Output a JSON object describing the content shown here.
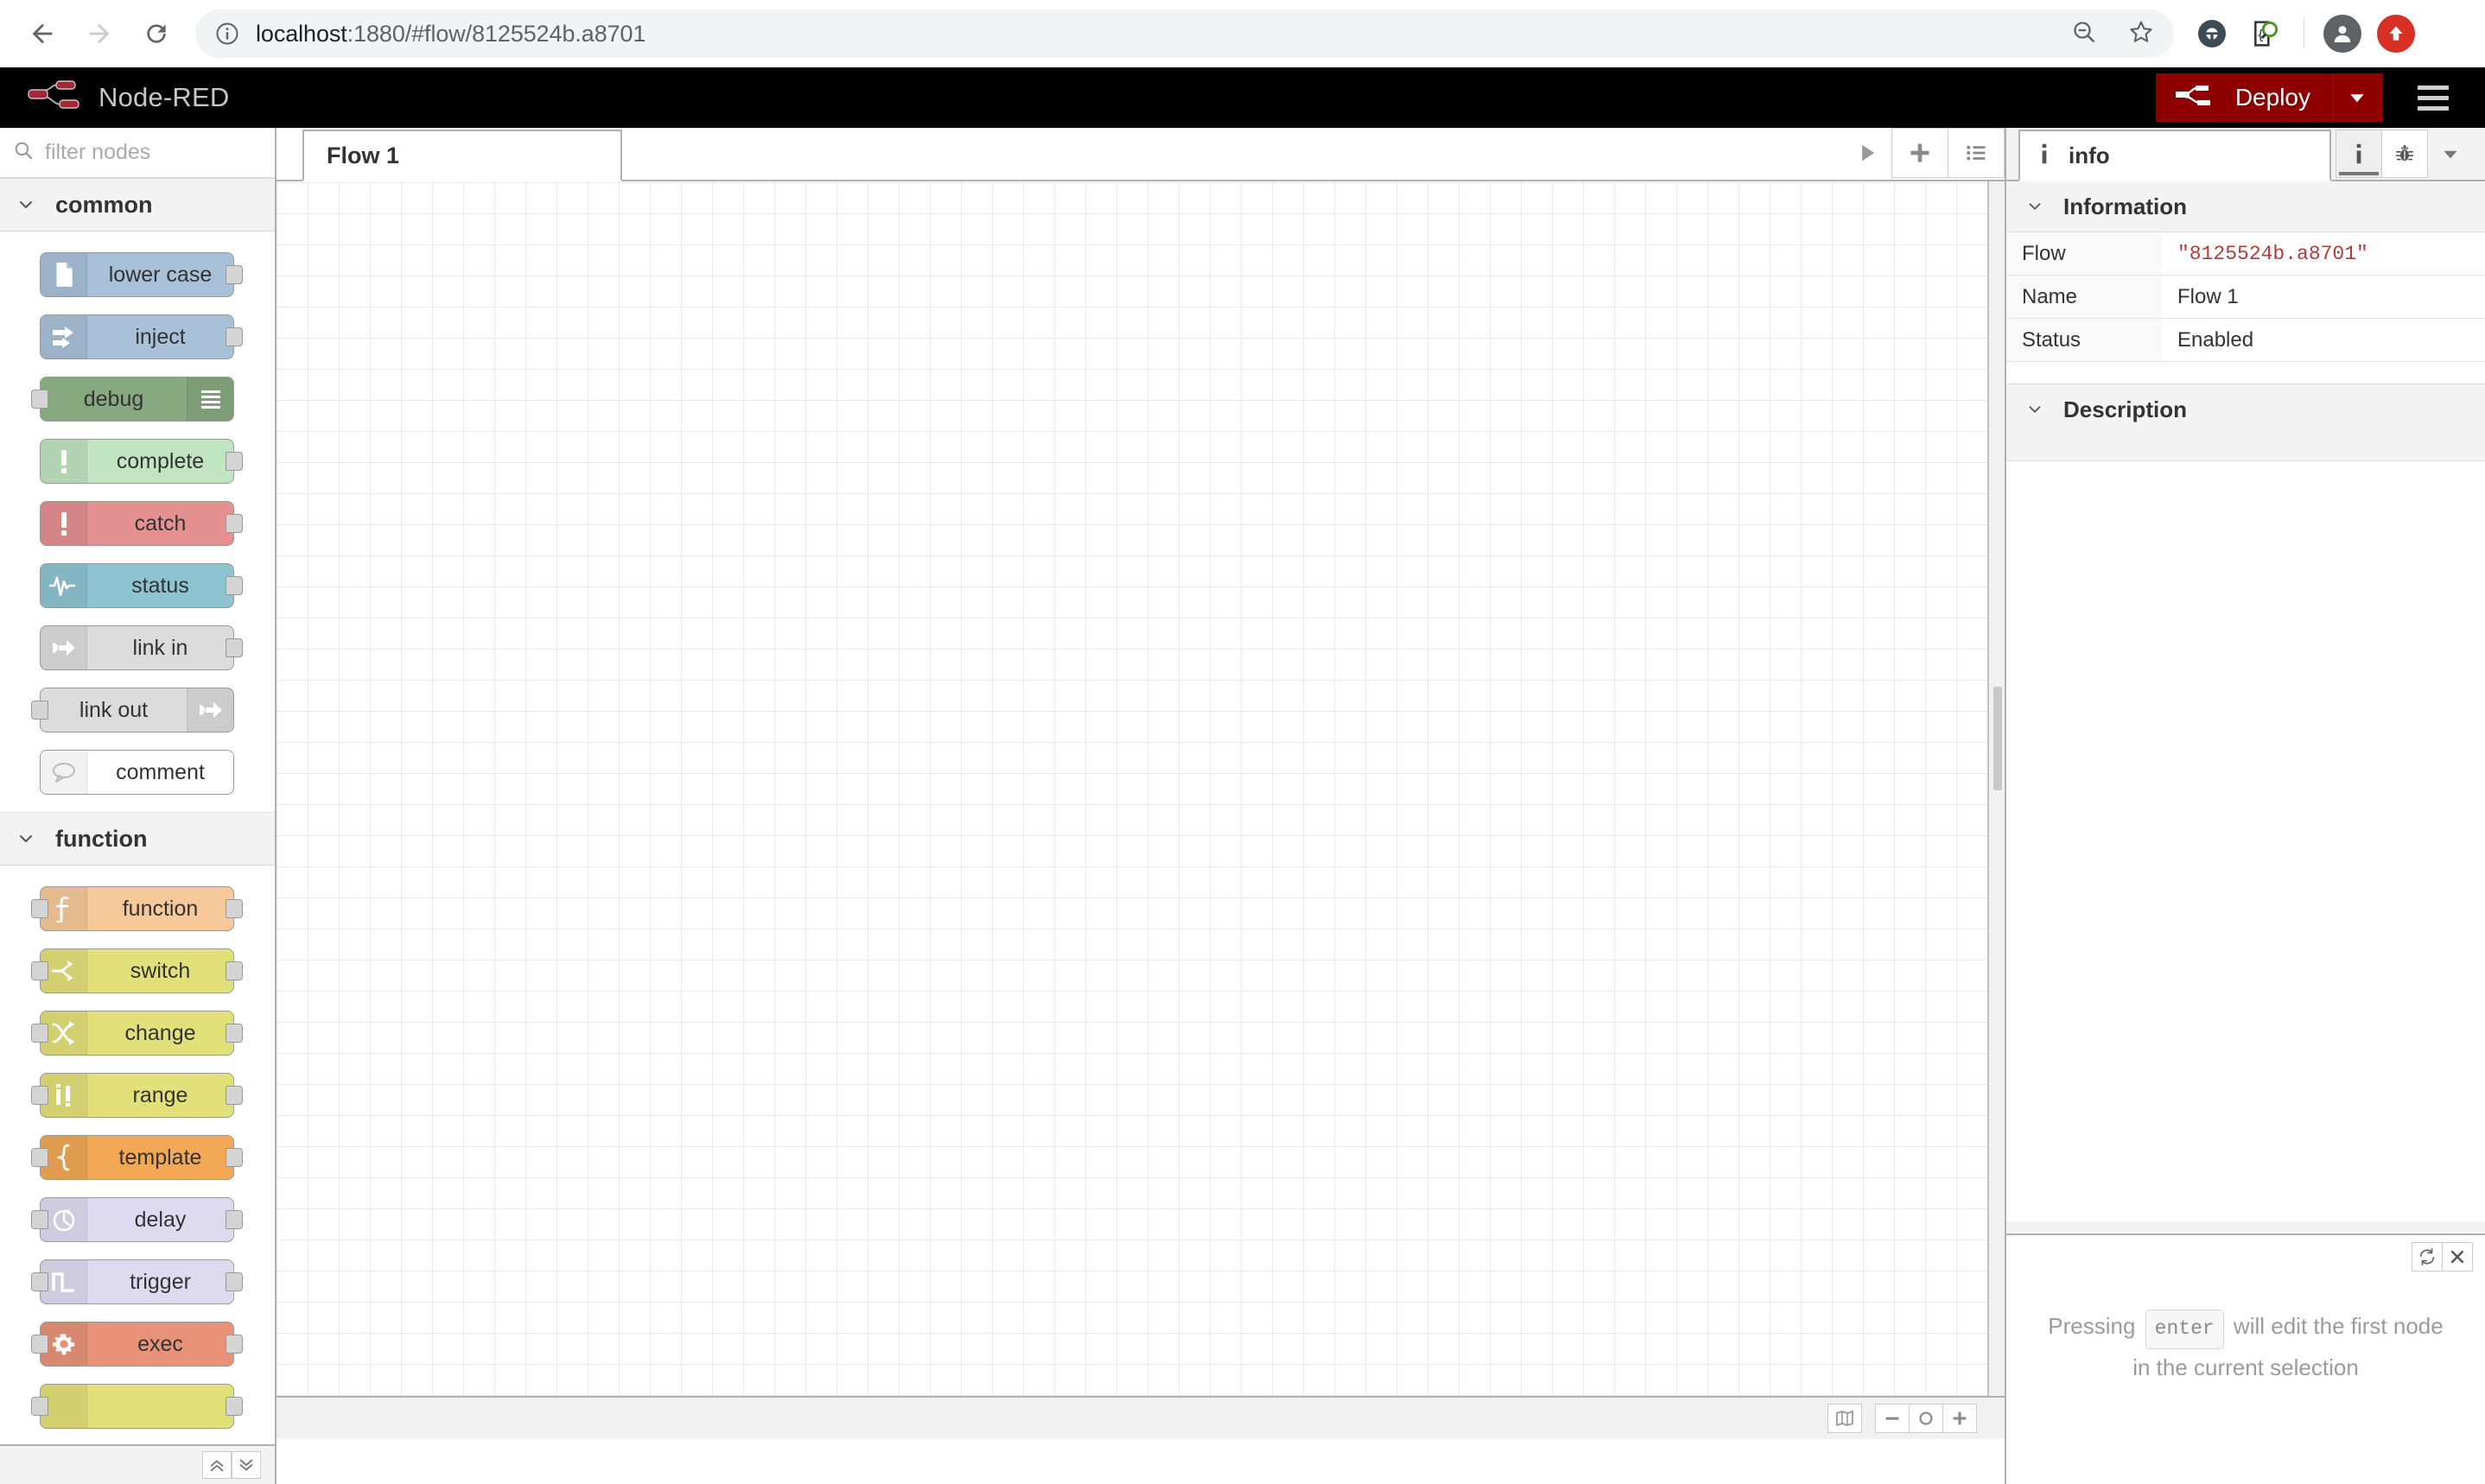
{
  "browser": {
    "back_icon": "back-arrow-icon",
    "forward_icon": "forward-arrow-icon",
    "reload_icon": "reload-icon",
    "info_icon": "site-info-icon",
    "url_host": "localhost",
    "url_rest": ":1880/#flow/8125524b.a8701",
    "url_full": "localhost:1880/#flow/8125524b.a8701",
    "zoom_out_icon": "zoom-out-icon",
    "bookmark_icon": "star-bookmark-icon",
    "ext1_icon": "extension-icon",
    "ext2_icon": "extension-search-icon",
    "profile_icon": "profile-avatar-icon",
    "update_icon": "update-arrow-icon"
  },
  "header": {
    "logo_icon": "node-red-logo-icon",
    "title": "Node-RED",
    "deploy_label": "Deploy",
    "deploy_icon": "deploy-node-icon",
    "deploy_caret_icon": "chevron-down-icon",
    "menu_icon": "hamburger-menu-icon",
    "deploy_color": "#8e0000"
  },
  "palette": {
    "search_placeholder": "filter nodes",
    "search_icon": "search-icon",
    "collapse_all_icon": "chevron-double-up-icon",
    "expand_all_icon": "chevron-double-down-icon",
    "categories": [
      {
        "name": "common",
        "chevron_icon": "chevron-down-icon",
        "nodes": [
          {
            "label": "lower case",
            "icon": "file-icon",
            "color": "#a8c0d8",
            "icon_side": "left",
            "in": false,
            "out": true
          },
          {
            "label": "inject",
            "icon": "inject-arrow-icon",
            "color": "#a8c0d8",
            "icon_side": "left",
            "in": false,
            "out": true
          },
          {
            "label": "debug",
            "icon": "list-lines-icon",
            "color": "#87a980",
            "icon_side": "right",
            "in": true,
            "out": false
          },
          {
            "label": "complete",
            "icon": "exclamation-icon",
            "color": "#c0e5c0",
            "icon_side": "left",
            "in": false,
            "out": true
          },
          {
            "label": "catch",
            "icon": "exclamation-icon",
            "color": "#e59191",
            "icon_side": "left",
            "in": false,
            "out": true
          },
          {
            "label": "status",
            "icon": "pulse-wave-icon",
            "color": "#8ec3d2",
            "icon_side": "left",
            "in": false,
            "out": true
          },
          {
            "label": "link in",
            "icon": "link-arrow-icon",
            "color": "#dcdcdc",
            "icon_side": "left",
            "in": false,
            "out": true
          },
          {
            "label": "link out",
            "icon": "link-arrow-icon",
            "color": "#dcdcdc",
            "icon_side": "right",
            "in": true,
            "out": false
          },
          {
            "label": "comment",
            "icon": "speech-bubble-icon",
            "color": "#ffffff",
            "icon_side": "left",
            "in": false,
            "out": false
          }
        ]
      },
      {
        "name": "function",
        "chevron_icon": "chevron-down-icon",
        "nodes": [
          {
            "label": "function",
            "icon": "integral-f-icon",
            "color": "#f6c99a",
            "icon_side": "left",
            "in": true,
            "out": true
          },
          {
            "label": "switch",
            "icon": "branch-arrows-icon",
            "color": "#e2e079",
            "icon_side": "left",
            "in": true,
            "out": true
          },
          {
            "label": "change",
            "icon": "swap-arrows-icon",
            "color": "#e2e079",
            "icon_side": "left",
            "in": true,
            "out": true
          },
          {
            "label": "range",
            "icon": "slider-icon",
            "color": "#e2e079",
            "icon_side": "left",
            "in": true,
            "out": true
          },
          {
            "label": "template",
            "icon": "brace-icon",
            "color": "#f2a854",
            "icon_side": "left",
            "in": true,
            "out": true
          },
          {
            "label": "delay",
            "icon": "stopwatch-icon",
            "color": "#dedbf0",
            "icon_side": "left",
            "in": true,
            "out": true
          },
          {
            "label": "trigger",
            "icon": "square-wave-icon",
            "color": "#dedbf0",
            "icon_side": "left",
            "in": true,
            "out": true
          },
          {
            "label": "exec",
            "icon": "gear-icon",
            "color": "#e9927a",
            "icon_side": "left",
            "in": true,
            "out": true
          },
          {
            "label": "",
            "icon": "partial-icon",
            "color": "#e2e079",
            "icon_side": "left",
            "in": true,
            "out": true
          }
        ]
      }
    ]
  },
  "workspace": {
    "tabs": [
      {
        "label": "Flow 1",
        "active": true
      }
    ],
    "run_icon": "play-arrow-icon",
    "add_tab_icon": "plus-icon",
    "list_tabs_icon": "list-menu-icon",
    "navigator_icon": "map-navigator-icon",
    "zoom_out_icon": "minus-icon",
    "zoom_reset_icon": "circle-icon",
    "zoom_in_icon": "plus-icon"
  },
  "sidebar": {
    "tab_label": "info",
    "tab_icon": "info-i-icon",
    "tool_info_icon": "info-i-icon",
    "tool_debug_icon": "bug-icon",
    "tool_caret_icon": "chevron-down-icon",
    "information": {
      "heading": "Information",
      "chevron_icon": "chevron-down-icon",
      "rows": [
        {
          "key": "Flow",
          "value": "\"8125524b.a8701\"",
          "mono": true
        },
        {
          "key": "Name",
          "value": "Flow 1",
          "mono": false
        },
        {
          "key": "Status",
          "value": "Enabled",
          "mono": false
        }
      ]
    },
    "description": {
      "heading": "Description",
      "chevron_icon": "chevron-down-icon"
    },
    "tip": {
      "refresh_icon": "refresh-cycle-icon",
      "close_icon": "close-x-icon",
      "text_before": "Pressing",
      "key": "enter",
      "text_after": "will edit the first node in the current selection"
    }
  }
}
